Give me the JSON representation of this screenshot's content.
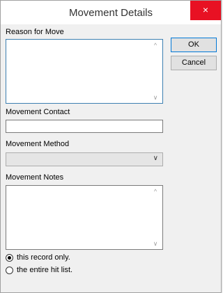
{
  "window": {
    "title": "Movement Details",
    "close_glyph": "×"
  },
  "buttons": {
    "ok": "OK",
    "cancel": "Cancel"
  },
  "fields": {
    "reason_label": "Reason for Move",
    "reason_value": "",
    "contact_label": "Movement Contact",
    "contact_value": "",
    "method_label": "Movement Method",
    "method_value": "",
    "notes_label": "Movement Notes",
    "notes_value": ""
  },
  "scope": {
    "options": [
      {
        "label": "this record only.",
        "selected": true
      },
      {
        "label": "the entire hit list.",
        "selected": false
      }
    ]
  },
  "icons": {
    "scroll_up": "^",
    "scroll_down": "∨",
    "dropdown": "∨"
  }
}
